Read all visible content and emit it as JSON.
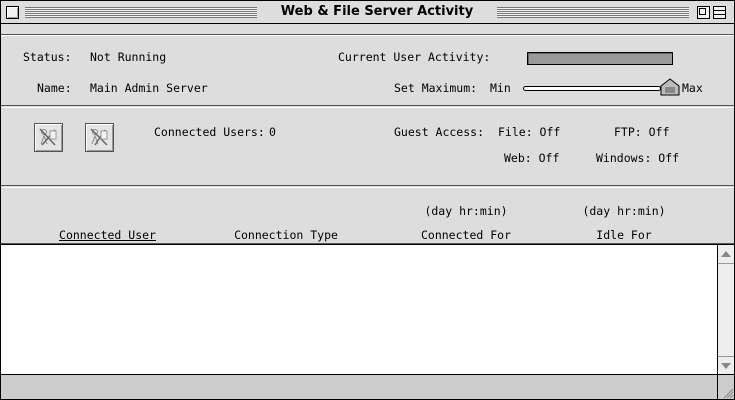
{
  "window": {
    "title": "Web & File Server Activity"
  },
  "status": {
    "label": "Status:",
    "value": "Not Running"
  },
  "name": {
    "label": "Name:",
    "value": "Main Admin Server"
  },
  "activity": {
    "label": "Current User Activity:"
  },
  "maximum": {
    "label": "Set Maximum:",
    "min_label": "Min",
    "max_label": "Max",
    "level": 1.0
  },
  "connected_users": {
    "label": "Connected Users:",
    "value": "0"
  },
  "guest_access": {
    "label": "Guest Access:",
    "file": "File: Off",
    "ftp": "FTP: Off",
    "web": "Web: Off",
    "windows": "Windows: Off"
  },
  "table": {
    "columns": [
      {
        "label": "Connected User",
        "unit": ""
      },
      {
        "label": "Connection Type",
        "unit": ""
      },
      {
        "label": "Connected For",
        "unit": "(day hr:min)"
      },
      {
        "label": "Idle For",
        "unit": "(day hr:min)"
      }
    ],
    "rows": []
  },
  "icons": [
    "close-box-icon",
    "zoom-box-icon",
    "collapse-box-icon",
    "disconnect-user-icon",
    "send-message-icon",
    "scroll-up-icon",
    "scroll-down-icon",
    "grow-box-icon"
  ]
}
